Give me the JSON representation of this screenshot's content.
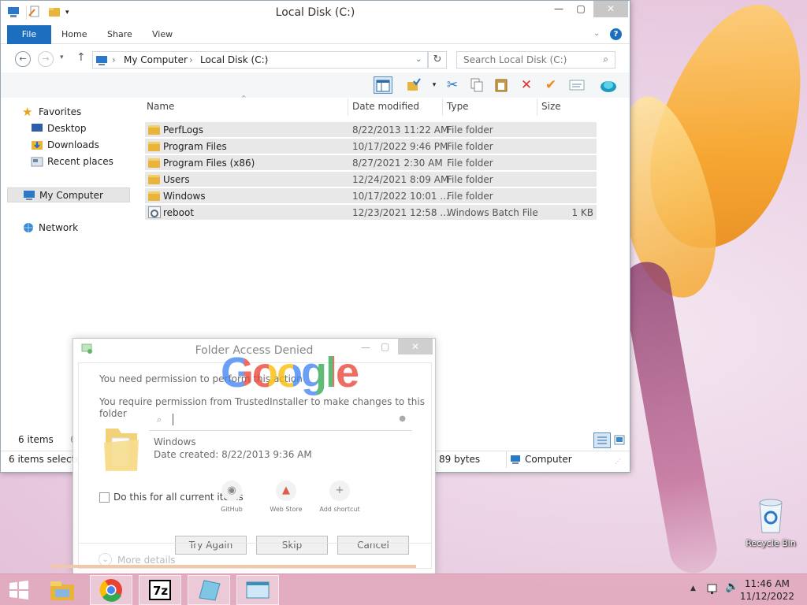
{
  "window": {
    "title": "Local Disk (C:)",
    "controls": {
      "minimize": "—",
      "maximize": "▢",
      "close": "✕"
    }
  },
  "ribbon": {
    "tabs": [
      {
        "label": "File"
      },
      {
        "label": "Home"
      },
      {
        "label": "Share"
      },
      {
        "label": "View"
      }
    ],
    "help": "?"
  },
  "address": {
    "crumbs": [
      "My Computer",
      "Local Disk (C:)"
    ],
    "search_placeholder": "Search Local Disk (C:)"
  },
  "navigation": {
    "favorites": "Favorites",
    "items": [
      "Desktop",
      "Downloads",
      "Recent places"
    ],
    "computer": "My Computer",
    "network": "Network"
  },
  "columns": {
    "name": "Name",
    "date": "Date modified",
    "type": "Type",
    "size": "Size"
  },
  "files": [
    {
      "name": "PerfLogs",
      "date": "8/22/2013 11:22 AM",
      "type": "File folder",
      "size": "",
      "icon": "folder-icon"
    },
    {
      "name": "Program Files",
      "date": "10/17/2022 9:46 PM",
      "type": "File folder",
      "size": "",
      "icon": "folder-icon"
    },
    {
      "name": "Program Files (x86)",
      "date": "8/27/2021 2:30 AM",
      "type": "File folder",
      "size": "",
      "icon": "folder-icon"
    },
    {
      "name": "Users",
      "date": "12/24/2021 8:09 AM",
      "type": "File folder",
      "size": "",
      "icon": "folder-icon"
    },
    {
      "name": "Windows",
      "date": "10/17/2022 10:01 ...",
      "type": "File folder",
      "size": "",
      "icon": "folder-icon"
    },
    {
      "name": "reboot",
      "date": "12/23/2021 12:58 ...",
      "type": "Windows Batch File",
      "size": "1 KB",
      "icon": "batch-file-icon"
    }
  ],
  "status": {
    "items": "6 items",
    "items_trunc": "6",
    "selected": "6 items selecte",
    "bytes": "89 bytes",
    "location": "Computer"
  },
  "dialog": {
    "title": "Folder Access Denied",
    "line1": "You need permission to perform this action",
    "line2a": "You require permission from TrustedInstaller to make changes to this",
    "line2b": "folder",
    "folder_name": "Windows",
    "folder_date": "Date created: 8/22/2013 9:36 AM",
    "checkbox": "Do this for all current items",
    "buttons": {
      "retry": "Try Again",
      "skip": "Skip",
      "cancel": "Cancel"
    },
    "more": "More details"
  },
  "overlay": {
    "logo": "Google",
    "shortcuts": [
      {
        "label": "GitHub"
      },
      {
        "label": "Web Store"
      },
      {
        "label": "Add shortcut",
        "glyph": "+"
      }
    ]
  },
  "desktop": {
    "recycle_bin": "Recycle Bin"
  },
  "taskbar": {
    "time": "11:46 AM",
    "date": "11/12/2022"
  },
  "colors": {
    "file_tab": "#1c6fbf",
    "delete_red": "#e0302a",
    "check_orange": "#f08a18"
  }
}
